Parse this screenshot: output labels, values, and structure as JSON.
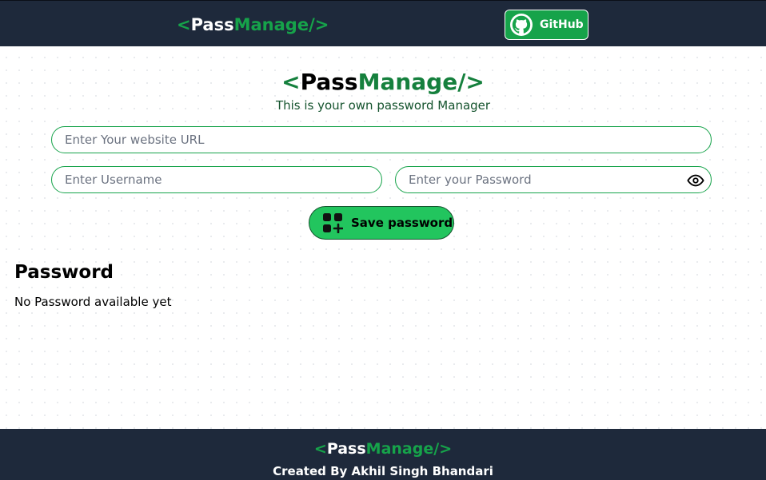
{
  "header": {
    "logo": {
      "lt": "<",
      "pass": "Pass",
      "manage": "Manage",
      "gt": "/>"
    },
    "github_label": "GitHub"
  },
  "main": {
    "logo": {
      "lt": "<",
      "pass": "Pass",
      "manage": "Manage",
      "gt": "/>"
    },
    "tagline": "This is your own password Manager",
    "url_placeholder": "Enter Your website URL",
    "username_placeholder": "Enter Username",
    "password_placeholder": "Enter your Password",
    "save_label": "Save password"
  },
  "passwords": {
    "heading": "Password",
    "empty_message": "No Password available yet"
  },
  "footer": {
    "logo": {
      "lt": "<",
      "pass": "Pass",
      "manage": "Manage",
      "gt": "/>"
    },
    "credit": "Created By Akhil Singh Bhandari"
  },
  "icons": {
    "github": "github-icon",
    "eye": "eye-icon",
    "save": "add-grid-icon"
  },
  "colors": {
    "navbar": "#1e293b",
    "accent": "#16a34a",
    "button": "#22c55e"
  }
}
